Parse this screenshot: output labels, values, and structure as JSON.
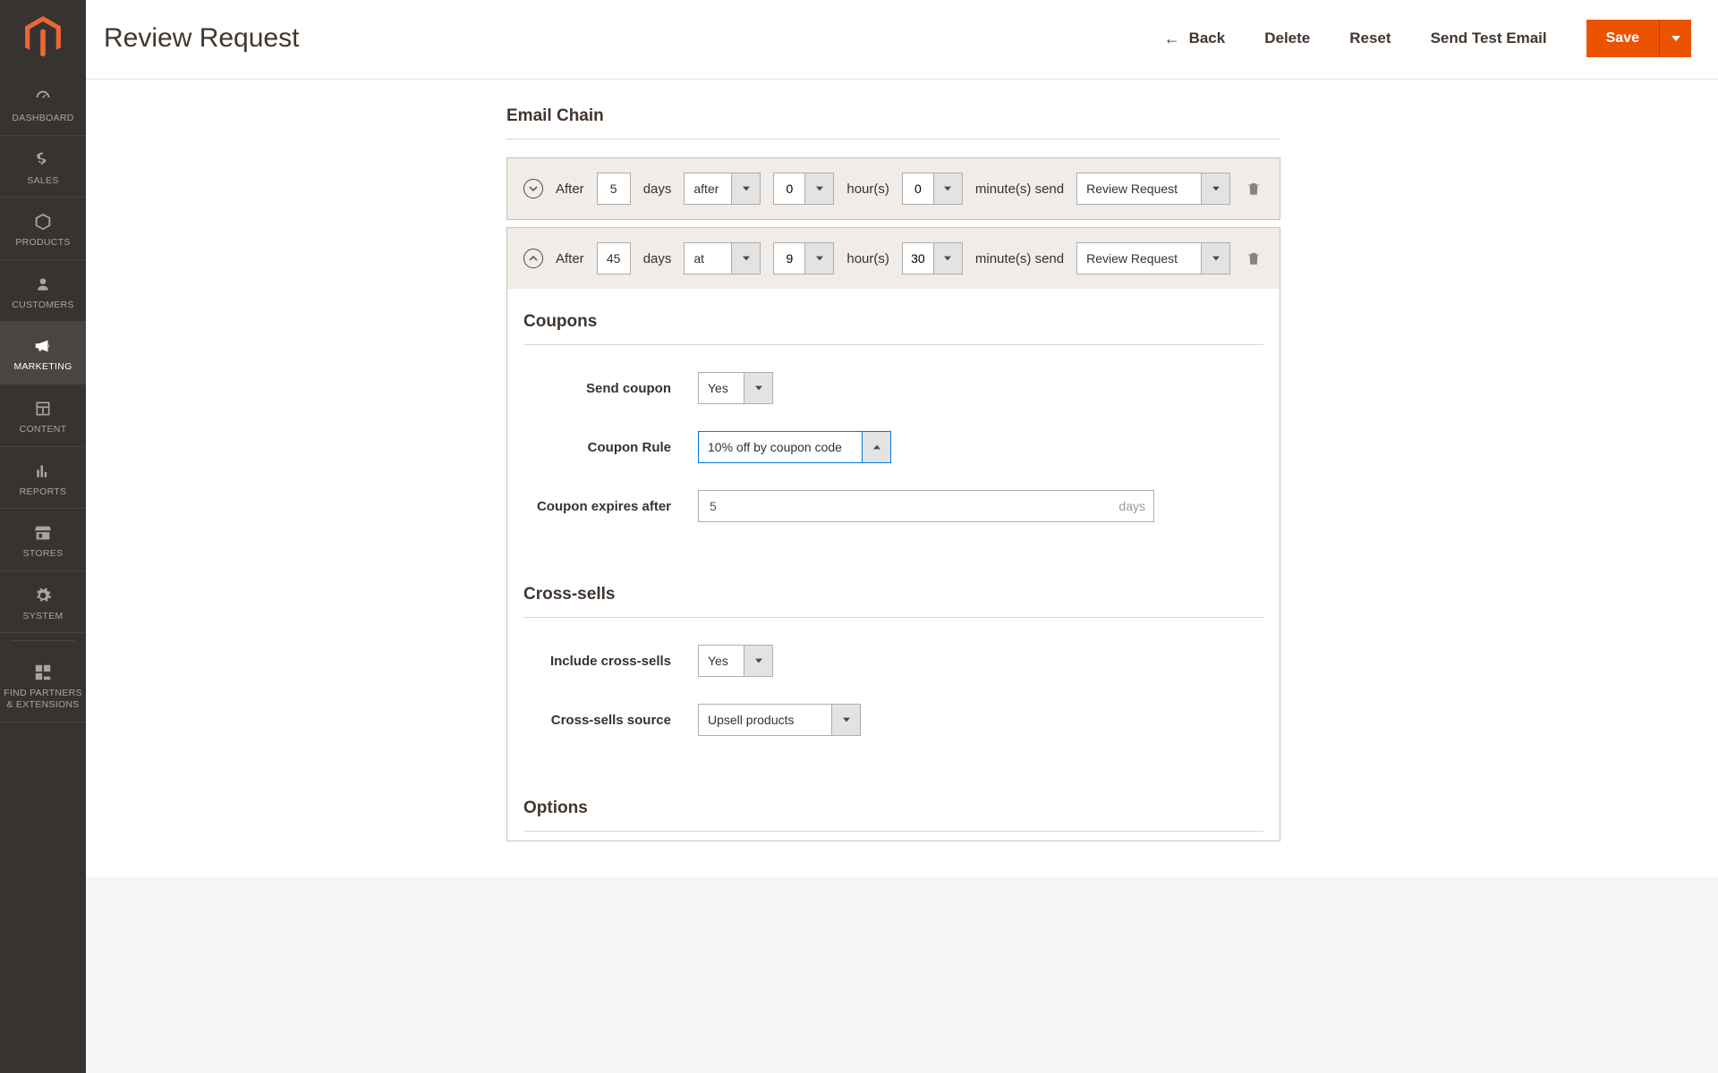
{
  "sidebar": {
    "items": [
      {
        "label": "DASHBOARD",
        "icon": "dashboard"
      },
      {
        "label": "SALES",
        "icon": "dollar"
      },
      {
        "label": "PRODUCTS",
        "icon": "box"
      },
      {
        "label": "CUSTOMERS",
        "icon": "person"
      },
      {
        "label": "MARKETING",
        "icon": "megaphone"
      },
      {
        "label": "CONTENT",
        "icon": "layout"
      },
      {
        "label": "REPORTS",
        "icon": "chart"
      },
      {
        "label": "STORES",
        "icon": "storefront"
      },
      {
        "label": "SYSTEM",
        "icon": "gear"
      },
      {
        "label": "FIND PARTNERS & EXTENSIONS",
        "icon": "blocks"
      }
    ]
  },
  "header": {
    "title": "Review Request",
    "back": "Back",
    "delete": "Delete",
    "reset": "Reset",
    "send_test": "Send Test Email",
    "save": "Save"
  },
  "sections": {
    "email_chain": "Email Chain",
    "coupons": "Coupons",
    "cross_sells": "Cross-sells",
    "options": "Options"
  },
  "chain": {
    "after_label": "After",
    "days_label": "days",
    "hours_label": "hour(s)",
    "minutes_send_label": "minute(s) send",
    "rows": [
      {
        "days": "5",
        "when": "after",
        "hours": "0",
        "minutes": "0",
        "template": "Review Request",
        "expanded": "down"
      },
      {
        "days": "45",
        "when": "at",
        "hours": "9",
        "minutes": "30",
        "template": "Review Request",
        "expanded": "up"
      }
    ]
  },
  "coupons": {
    "send_label": "Send coupon",
    "send_value": "Yes",
    "rule_label": "Coupon Rule",
    "rule_value": "10% off by coupon code",
    "expires_label": "Coupon expires after",
    "expires_value": "5",
    "expires_suffix": "days"
  },
  "cross": {
    "include_label": "Include cross-sells",
    "include_value": "Yes",
    "source_label": "Cross-sells source",
    "source_value": "Upsell products"
  }
}
